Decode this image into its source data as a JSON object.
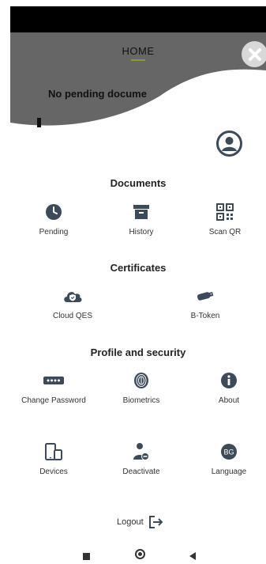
{
  "header": {
    "title": "HOME",
    "message": "No pending docume"
  },
  "sections": {
    "documents": "Documents",
    "certificates": "Certificates",
    "profile": "Profile and security"
  },
  "documents_items": [
    "Pending",
    "History",
    "Scan QR"
  ],
  "certificates_items": [
    "Cloud QES",
    "B-Token"
  ],
  "profile_items": [
    "Change Password",
    "Biometrics",
    "About"
  ],
  "device_items": [
    "Devices",
    "Deactivate",
    "Language"
  ],
  "language_badge": "BG",
  "logout_label": "Logout",
  "icons": {
    "pending": "clock-icon",
    "history": "archive-icon",
    "scan": "qr-code-icon",
    "cloud": "cloud-shield-icon",
    "btoken": "usb-token-icon",
    "password": "password-dots-icon",
    "biometrics": "fingerprint-icon",
    "about": "info-icon",
    "devices": "devices-icon",
    "deactivate": "user-remove-icon",
    "language": "language-icon"
  },
  "colors": {
    "icon": "#3c4a5a",
    "background": "#ffffff",
    "header": "#666666"
  }
}
